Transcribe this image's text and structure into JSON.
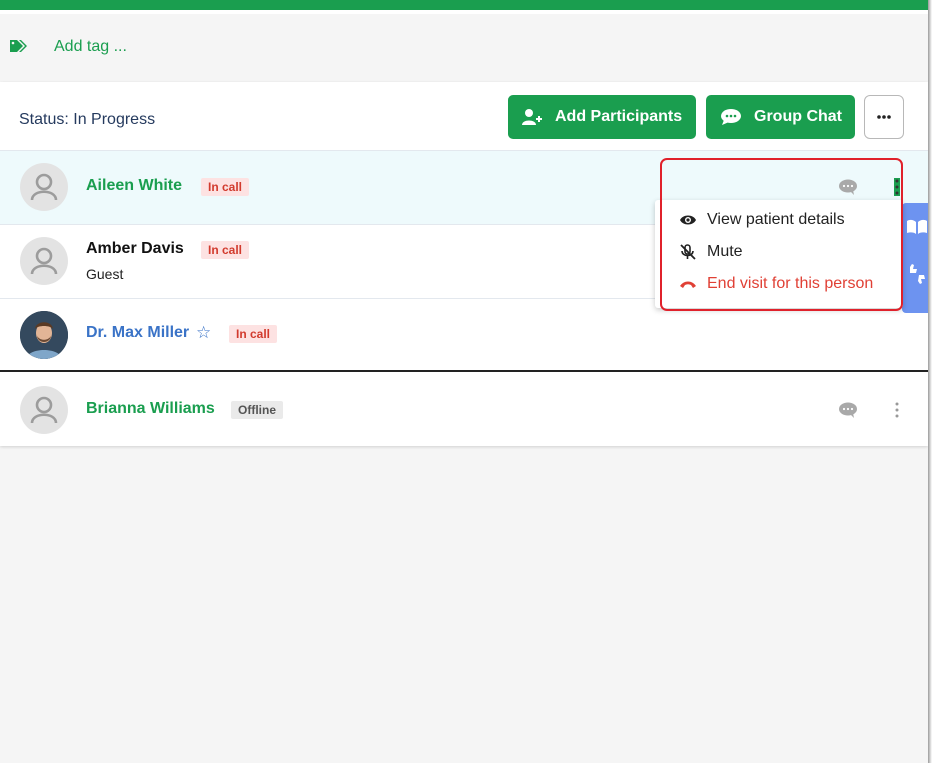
{
  "tag_row": {
    "label": "Add tag ..."
  },
  "status": {
    "text": "Status: In Progress"
  },
  "toolbar": {
    "add_participants": "Add Participants",
    "group_chat": "Group Chat",
    "more": "..."
  },
  "participants": [
    {
      "name": "Aileen White",
      "badge": "In call"
    },
    {
      "name": "Amber Davis",
      "badge": "In call",
      "role": "Guest"
    },
    {
      "name": "Dr. Max Miller",
      "badge": "In call",
      "star": "☆"
    },
    {
      "name": "Brianna Williams",
      "badge": "Offline"
    }
  ],
  "context_menu": {
    "view_details": "View patient details",
    "mute": "Mute",
    "end_visit": "End visit for this person"
  },
  "colors": {
    "brand_green": "#1a9e4f",
    "danger": "#e0212b",
    "link_blue": "#3a73c7",
    "side_tab": "#6d93f0"
  },
  "icons": {
    "tag": "tags-icon",
    "add_participants": "user-plus-icon",
    "group_chat": "comment-icon",
    "row_chat": "chat-bubble-icon",
    "row_more": "kebab-icon",
    "view": "eye-icon",
    "mute": "microphone-slash-icon",
    "end": "phone-hangup-icon",
    "side_tab": "book-open-icon",
    "side_tab_2": "thumbs-icon"
  }
}
